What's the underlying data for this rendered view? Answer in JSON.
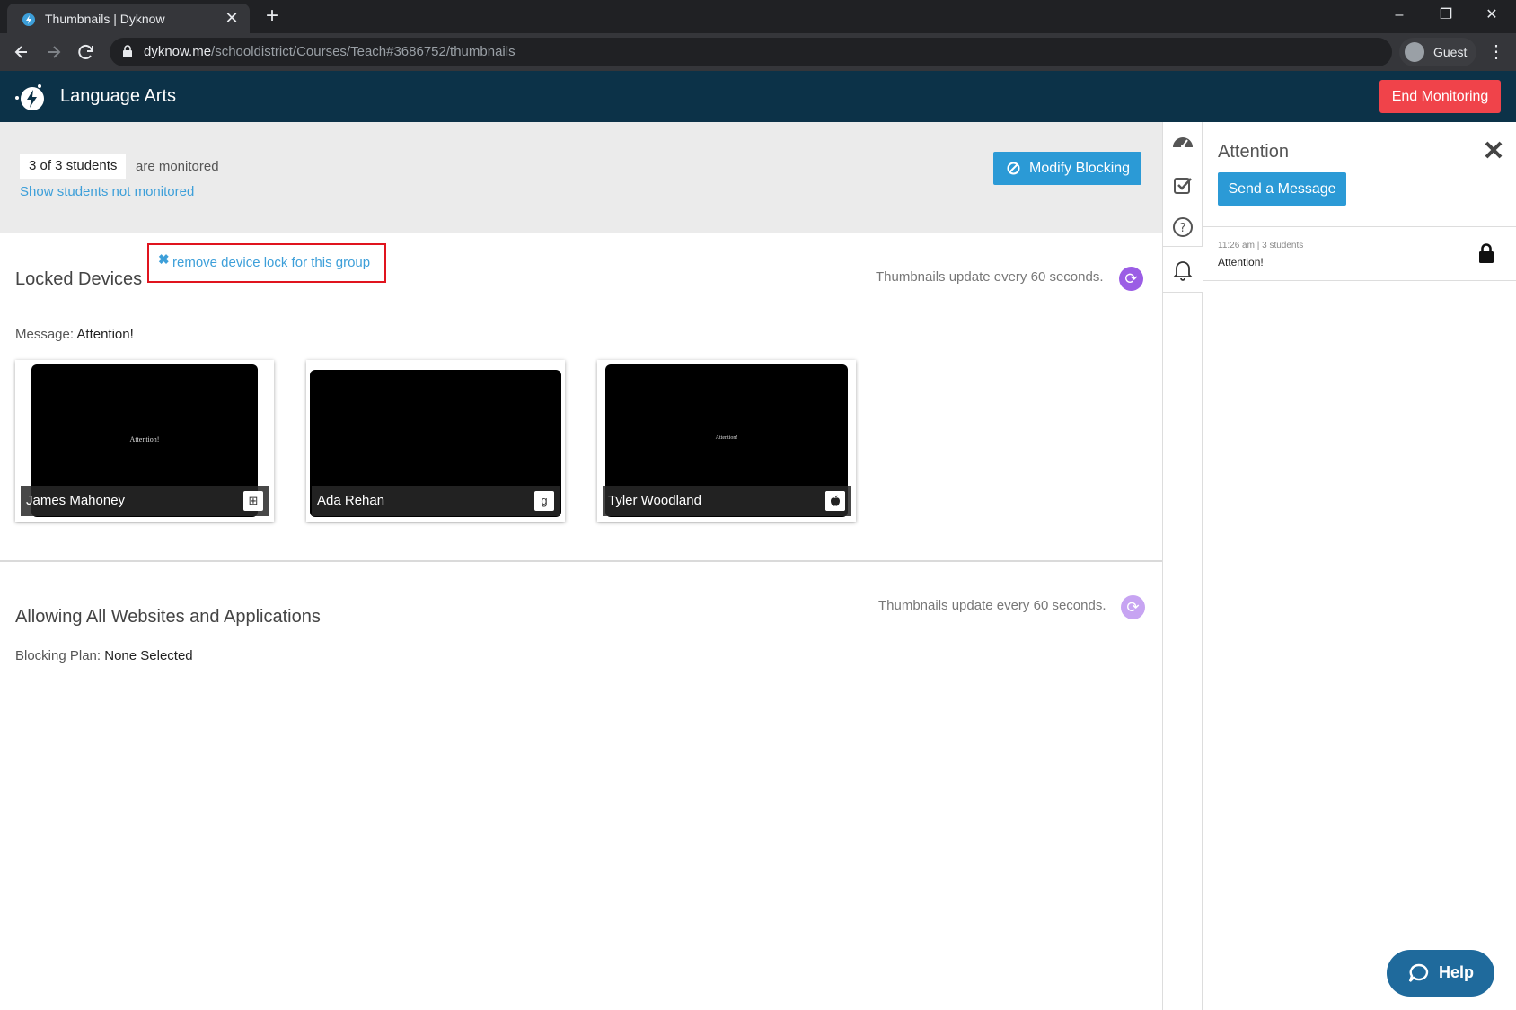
{
  "browser": {
    "tab_title": "Thumbnails | Dyknow",
    "tab_close": "✕",
    "new_tab": "+",
    "url_host": "dyknow.me",
    "url_path": "/schooldistrict/Courses/Teach#3686752/thumbnails",
    "profile_label": "Guest",
    "window_controls": [
      "–",
      "❐",
      "✕"
    ]
  },
  "header": {
    "title": "Language Arts",
    "end_button": "End Monitoring"
  },
  "monitor": {
    "count": "3 of 3 students",
    "count_suffix": "are monitored",
    "show_link": "Show students not monitored",
    "modify_button": "Modify Blocking"
  },
  "locked": {
    "title": "Locked Devices",
    "remove_link": "remove device lock for this group",
    "update_text": "Thumbnails update every 60 seconds.",
    "message_label": "Message:",
    "message_value": "Attention!",
    "students": [
      {
        "name": "James Mahoney",
        "os": "windows-icon",
        "screen_text": "Attention!"
      },
      {
        "name": "Ada Rehan",
        "os": "google-icon",
        "screen_text": ""
      },
      {
        "name": "Tyler Woodland",
        "os": "apple-icon",
        "screen_text": "Attention!"
      }
    ]
  },
  "allowing": {
    "title": "Allowing All Websites and Applications",
    "update_text": "Thumbnails update every 60 seconds.",
    "plan_label": "Blocking Plan:",
    "plan_value": "None Selected"
  },
  "panel": {
    "title": "Attention",
    "send_button": "Send a Message",
    "message_time": "11:26 am",
    "message_separator": "|",
    "message_count": "3 students",
    "message_text": "Attention!"
  },
  "help": {
    "label": "Help"
  },
  "colors": {
    "header_bg": "#0c3248",
    "accent_blue": "#2b9ad6",
    "danger_red": "#f0434a",
    "refresh_purple": "#9b5de5"
  }
}
